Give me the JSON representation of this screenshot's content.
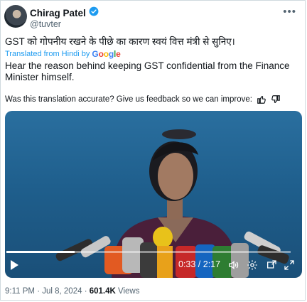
{
  "tweet": {
    "author_name": "Chirag Patel",
    "handle": "@tuvter",
    "text_hindi": "GST को गोपनीय रखने के पीछे का कारण स्वयं वित्त मंत्री से सुनिए।",
    "translated_from": "Translated from Hindi by",
    "translator_brand": "Google",
    "translation": "Hear the reason behind keeping GST confidential from the Finance Minister himself.",
    "feedback_prompt": "Was this translation accurate? Give us feedback so we can improve:",
    "time": "9:11 PM",
    "date": "Jul 8, 2024",
    "views_count": "601.4K",
    "views_label": "Views"
  },
  "video": {
    "time_display": "0:33 / 2:17",
    "progress_fraction": 0.24
  },
  "colors": {
    "verified": "#1d9bf0",
    "link": "#1d9bf0",
    "google": [
      "#4285f4",
      "#ea4335",
      "#fbbc05",
      "#4285f4",
      "#34a853",
      "#ea4335"
    ]
  },
  "icons": [
    "verified-badge-icon",
    "more-icon",
    "thumbs-up-icon",
    "thumbs-down-icon",
    "play-icon",
    "volume-icon",
    "settings-icon",
    "pip-icon",
    "fullscreen-icon"
  ]
}
